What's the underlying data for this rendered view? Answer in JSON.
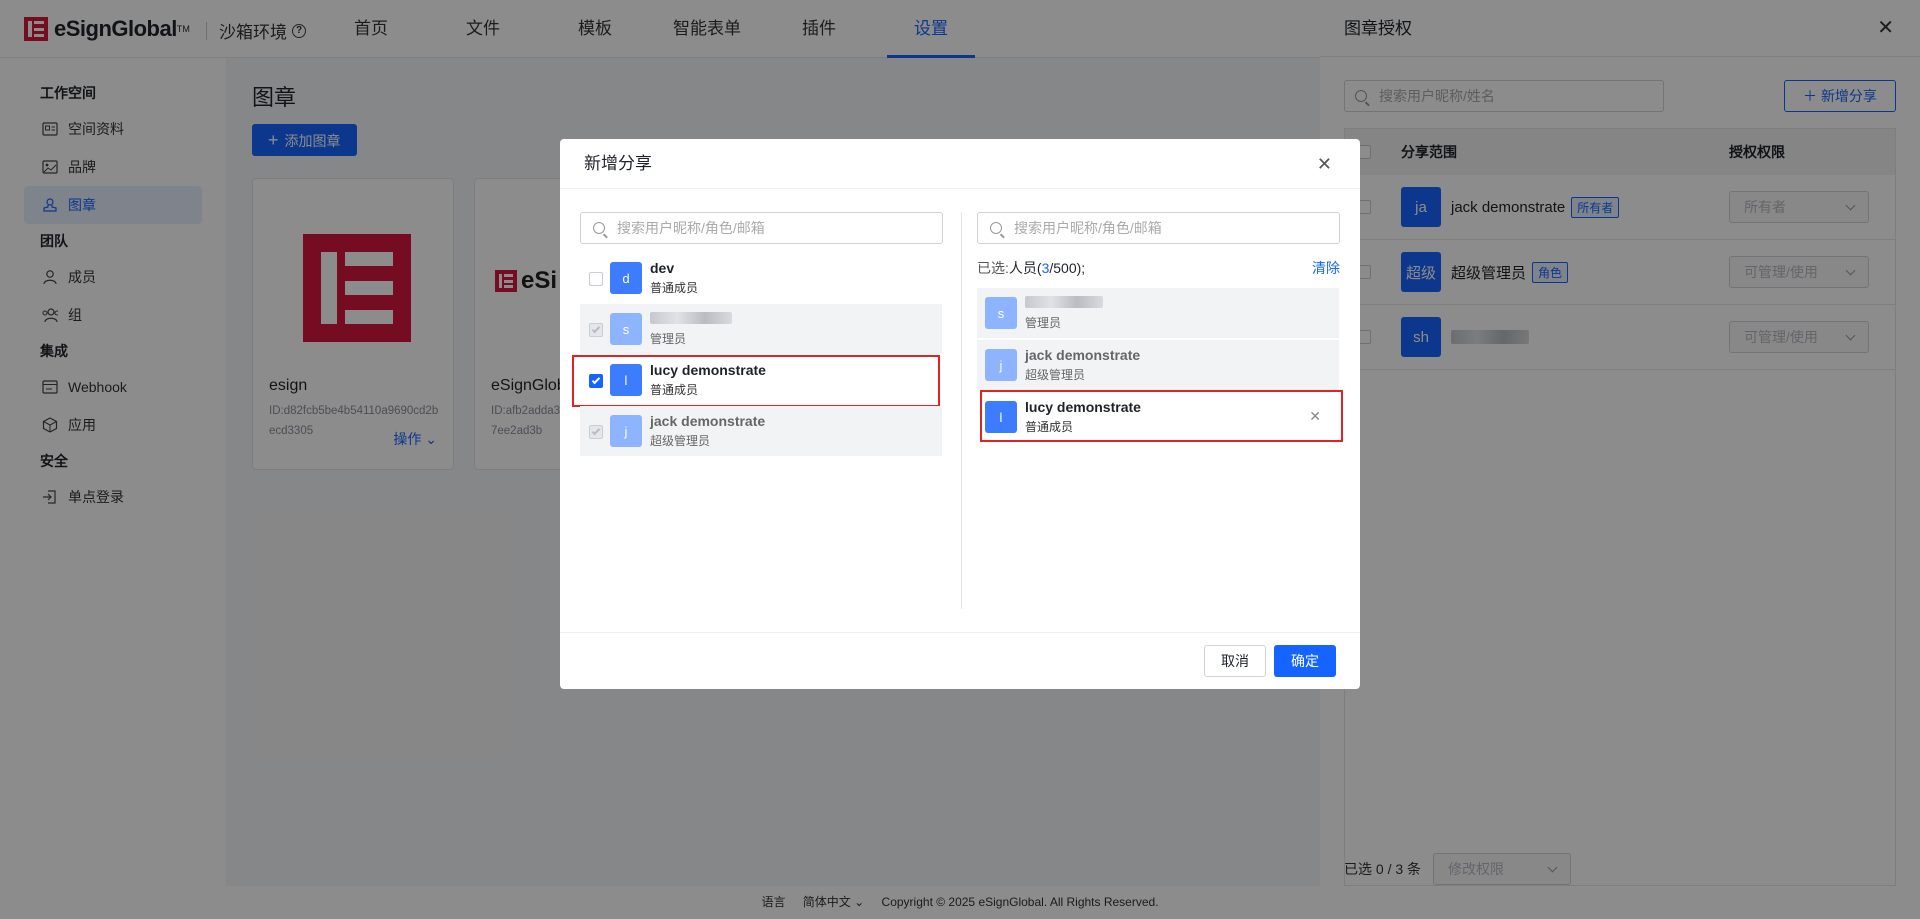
{
  "brand": {
    "logo_text": "eSignGlobal",
    "tm": "TM",
    "env": "沙箱环境",
    "color": "#d7163c"
  },
  "nav": [
    {
      "label": "首页"
    },
    {
      "label": "文件"
    },
    {
      "label": "模板"
    },
    {
      "label": "智能表单"
    },
    {
      "label": "插件"
    },
    {
      "label": "设置",
      "active": true
    }
  ],
  "sidebar": {
    "groups": [
      {
        "title": "工作空间",
        "items": [
          {
            "label": "空间资料",
            "icon": "id-card-icon"
          },
          {
            "label": "品牌",
            "icon": "image-icon"
          },
          {
            "label": "图章",
            "icon": "stamp-icon",
            "active": true
          }
        ]
      },
      {
        "title": "团队",
        "items": [
          {
            "label": "成员",
            "icon": "user-icon"
          },
          {
            "label": "组",
            "icon": "group-icon"
          }
        ]
      },
      {
        "title": "集成",
        "items": [
          {
            "label": "Webhook",
            "icon": "webhook-icon"
          },
          {
            "label": "应用",
            "icon": "cube-icon"
          }
        ]
      },
      {
        "title": "安全",
        "items": [
          {
            "label": "单点登录",
            "icon": "login-icon"
          }
        ]
      }
    ]
  },
  "main": {
    "title": "图章",
    "add_label": "添加图章",
    "cards": [
      {
        "name": "esign",
        "id": "ID:d82fcb5be4b54110a9690cd2becd3305",
        "op": "操作"
      },
      {
        "name": "eSignGlob",
        "id": "ID:afb2adda3 87ee2ad3b",
        "op": ""
      }
    ]
  },
  "footer": {
    "lang_label": "语言",
    "lang_value": "简体中文",
    "copyright": "Copyright © 2025 eSignGlobal. All Rights Reserved."
  },
  "drawer": {
    "title": "图章授权",
    "search_placeholder": "搜索用户昵称/姓名",
    "add_label": "新增分享",
    "col_scope": "分享范围",
    "col_perm": "授权权限",
    "rows": [
      {
        "avatar": "ja",
        "name": "jack demonstrate",
        "tag": "所有者",
        "perm": "所有者"
      },
      {
        "avatar": "超级",
        "name": "超级管理员",
        "tag": "角色",
        "perm": "可管理/使用"
      },
      {
        "avatar": "sh",
        "name": "",
        "tag": "",
        "perm": "可管理/使用"
      }
    ],
    "footer_selected": "已选 0 / 3 条",
    "footer_action": "修改权限"
  },
  "modal": {
    "title": "新增分享",
    "left_search_placeholder": "搜索用户昵称/角色/邮箱",
    "right_search_placeholder": "搜索用户昵称/角色/邮箱",
    "left_list": [
      {
        "avatar": "d",
        "name": "dev",
        "role": "普通成员",
        "state": "unchecked"
      },
      {
        "avatar": "s",
        "name": "",
        "role": "管理员",
        "state": "disabled"
      },
      {
        "avatar": "l",
        "name": "lucy demonstrate",
        "role": "普通成员",
        "state": "checked"
      },
      {
        "avatar": "j",
        "name": "jack demonstrate",
        "role": "超级管理员",
        "state": "disabled"
      }
    ],
    "selected_prefix": "已选:",
    "selected_people": "人员(",
    "selected_count": "3",
    "selected_total": "/500);",
    "clear_label": "清除",
    "right_list": [
      {
        "avatar": "s",
        "name": "",
        "role": "管理员"
      },
      {
        "avatar": "j",
        "name": "jack demonstrate",
        "role": "超级管理员"
      },
      {
        "avatar": "l",
        "name": "lucy demonstrate",
        "role": "普通成员",
        "removable": true
      }
    ],
    "cancel_label": "取消",
    "ok_label": "确定"
  },
  "colors": {
    "primary": "#1664ff",
    "highlight": "#e02222"
  }
}
